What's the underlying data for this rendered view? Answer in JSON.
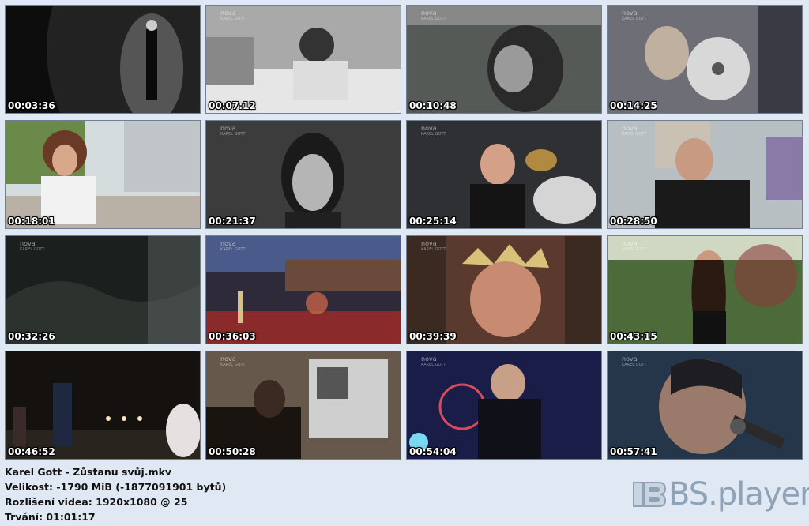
{
  "channel_logo": {
    "main": "nova",
    "sub": "KAREL GOTT"
  },
  "thumbnails": [
    {
      "time": "00:03:36",
      "scene": "stage-spotlight",
      "bg": "#2b2b2b"
    },
    {
      "time": "00:07:12",
      "scene": "hospital-bed",
      "bg": "#9a9a9a"
    },
    {
      "time": "00:10:48",
      "scene": "close-up-singing-bw",
      "bg": "#4a4f4a"
    },
    {
      "time": "00:14:25",
      "scene": "record-award",
      "bg": "#7a7a80"
    },
    {
      "time": "00:18:01",
      "scene": "woman-interview-terrace",
      "bg": "#cfd6d8"
    },
    {
      "time": "00:21:37",
      "scene": "singer-microphone-bw",
      "bg": "#3a3a3a"
    },
    {
      "time": "00:25:14",
      "scene": "drums-stage",
      "bg": "#3b3d40"
    },
    {
      "time": "00:28:50",
      "scene": "man-interview-shelves",
      "bg": "#b8c0c4"
    },
    {
      "time": "00:32:26",
      "scene": "dark-landscape",
      "bg": "#1e2220"
    },
    {
      "time": "00:36:03",
      "scene": "open-air-concert",
      "bg": "#3a2f3a"
    },
    {
      "time": "00:39:39",
      "scene": "crown-singer",
      "bg": "#5a3a2e"
    },
    {
      "time": "00:43:15",
      "scene": "woman-garden",
      "bg": "#5e7a4a"
    },
    {
      "time": "00:46:52",
      "scene": "concert-stage-band",
      "bg": "#1a1512"
    },
    {
      "time": "00:50:28",
      "scene": "studio-photos",
      "bg": "#6a5e50"
    },
    {
      "time": "00:54:04",
      "scene": "blue-stage-singer",
      "bg": "#1c1f4a"
    },
    {
      "time": "00:57:41",
      "scene": "singer-mic-closeup",
      "bg": "#2a3a4a"
    }
  ],
  "file_info": {
    "title": "Karel Gott - Zůstanu svůj.mkv",
    "size": "Velikost: -1790 MiB (-1877091901 bytů)",
    "resolution": "Rozlišení videa: 1920x1080 @ 25",
    "duration": "Trvání: 01:01:17"
  },
  "brand": {
    "name": "BS.player",
    "accent": "#8fa3b8"
  }
}
